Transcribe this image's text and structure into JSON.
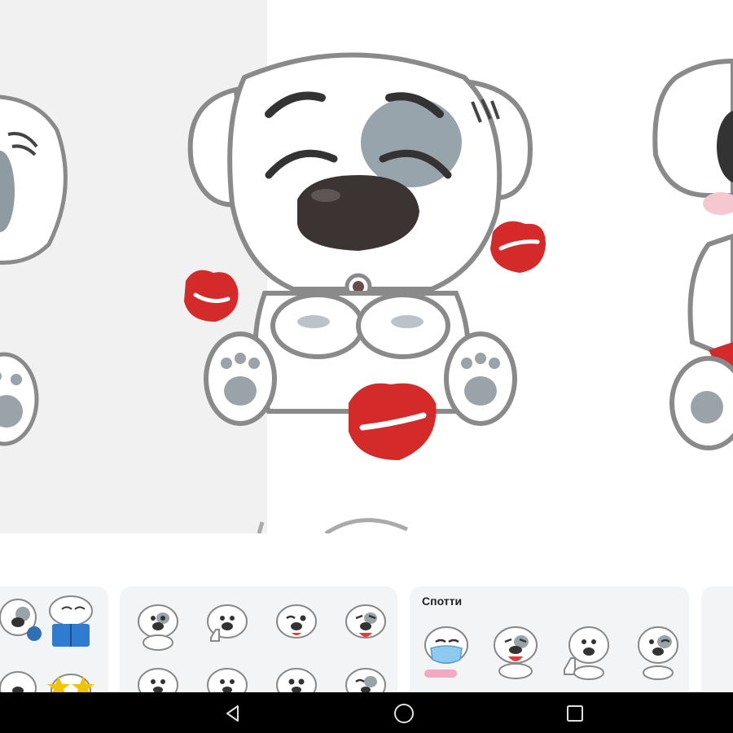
{
  "hero": {
    "subject": "dog-sticker-blowing-kisses",
    "background_left": "#f1f1f1",
    "background_right": "#ffffff",
    "kiss_color": "#d42a2a"
  },
  "sticker_packs": [
    {
      "title": "",
      "stickers": [
        "dog-sticker",
        "dog-reading-book-sticker",
        "dog-sticker",
        "dog-stars-sticker"
      ]
    },
    {
      "title": "",
      "stickers": [
        "dog-sticker",
        "dog-thumbs-up-sticker",
        "dog-winking-sticker",
        "dog-laughing-sticker",
        "dog-sticker",
        "dog-sticker",
        "dog-sticker",
        "dog-sticker"
      ]
    },
    {
      "title": "Спотти",
      "stickers": [
        "dog-mask-sticker",
        "dog-laughing-sticker",
        "dog-thumbs-up-sticker",
        "dog-winking-sticker"
      ]
    },
    {
      "title": "",
      "stickers": []
    }
  ],
  "navbar": {
    "buttons": [
      "back-icon",
      "home-icon",
      "recents-icon"
    ],
    "icon_color": "#e0e0e0"
  }
}
